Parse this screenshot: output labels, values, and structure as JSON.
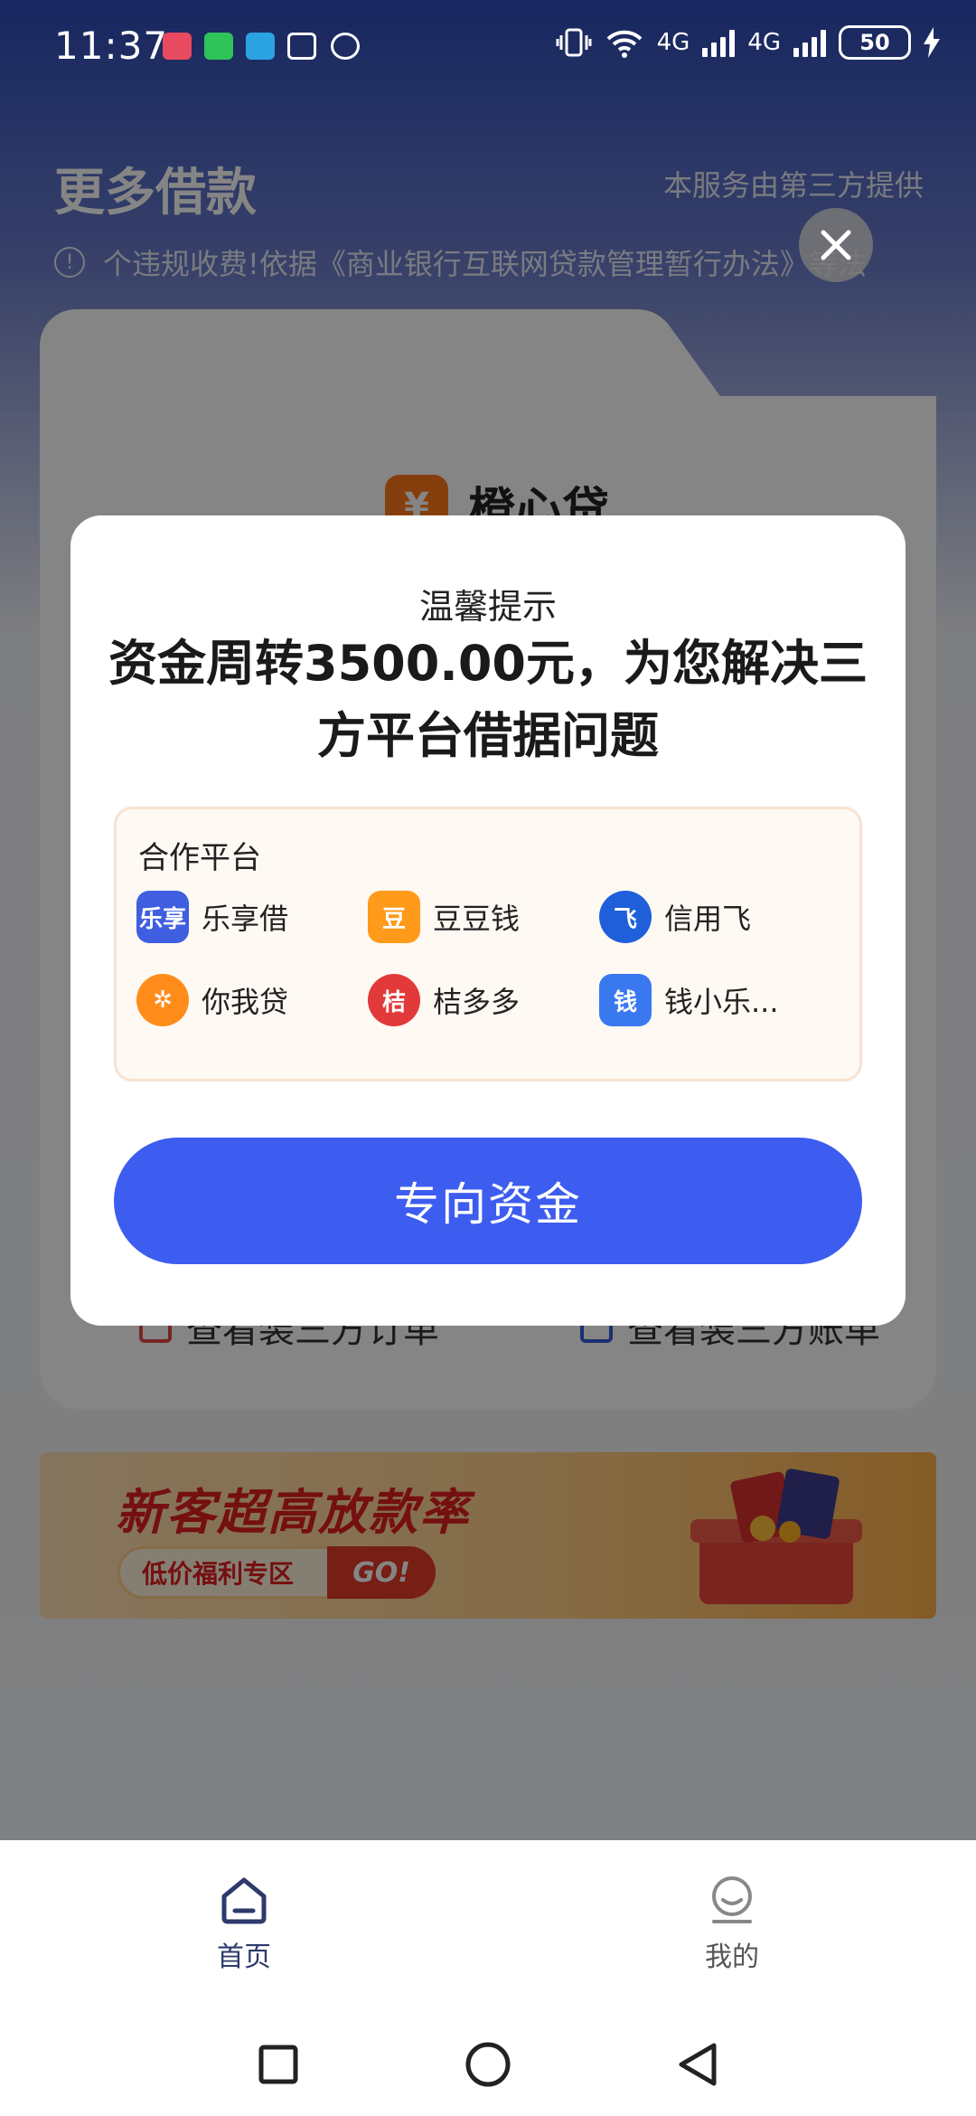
{
  "status_bar": {
    "time": "11:37",
    "network_1": "4G",
    "network_2": "4G",
    "battery": "50"
  },
  "header": {
    "title": "更多借款",
    "service_note": "本服务由第三方提供",
    "notice_text": "个违规收费!依据《商业银行互联网贷款管理暂行办法》等法"
  },
  "card": {
    "brand_name": "橙心贷",
    "brand_logo_char": "¥",
    "link_left": "查看装三方订单",
    "link_right": "查看装三方账单"
  },
  "banner": {
    "title": "新客超高放款率",
    "pill": "低价福利专区",
    "go": "GO!"
  },
  "modal": {
    "kicker": "温馨提示",
    "headline": "资金周转3500.00元，为您解决三方平台借据问题",
    "partners_title": "合作平台",
    "partners": [
      {
        "name": "乐享借",
        "logo_text": "乐享",
        "color": "#3f5fe0"
      },
      {
        "name": "豆豆钱",
        "logo_text": "豆",
        "color": "#ff9a1a"
      },
      {
        "name": "信用飞",
        "logo_text": "飞",
        "color": "#1f5fd9"
      },
      {
        "name": "你我贷",
        "logo_text": "✲",
        "color": "#ff8c1a"
      },
      {
        "name": "桔多多",
        "logo_text": "桔",
        "color": "#e23a3a"
      },
      {
        "name": "钱小乐...",
        "logo_text": "钱",
        "color": "#3a78f0"
      }
    ],
    "cta": "专向资金"
  },
  "tabbar": {
    "home": "首页",
    "mine": "我的"
  },
  "colors": {
    "primary": "#3d5cf0",
    "header_blue": "#2d4bb8"
  }
}
